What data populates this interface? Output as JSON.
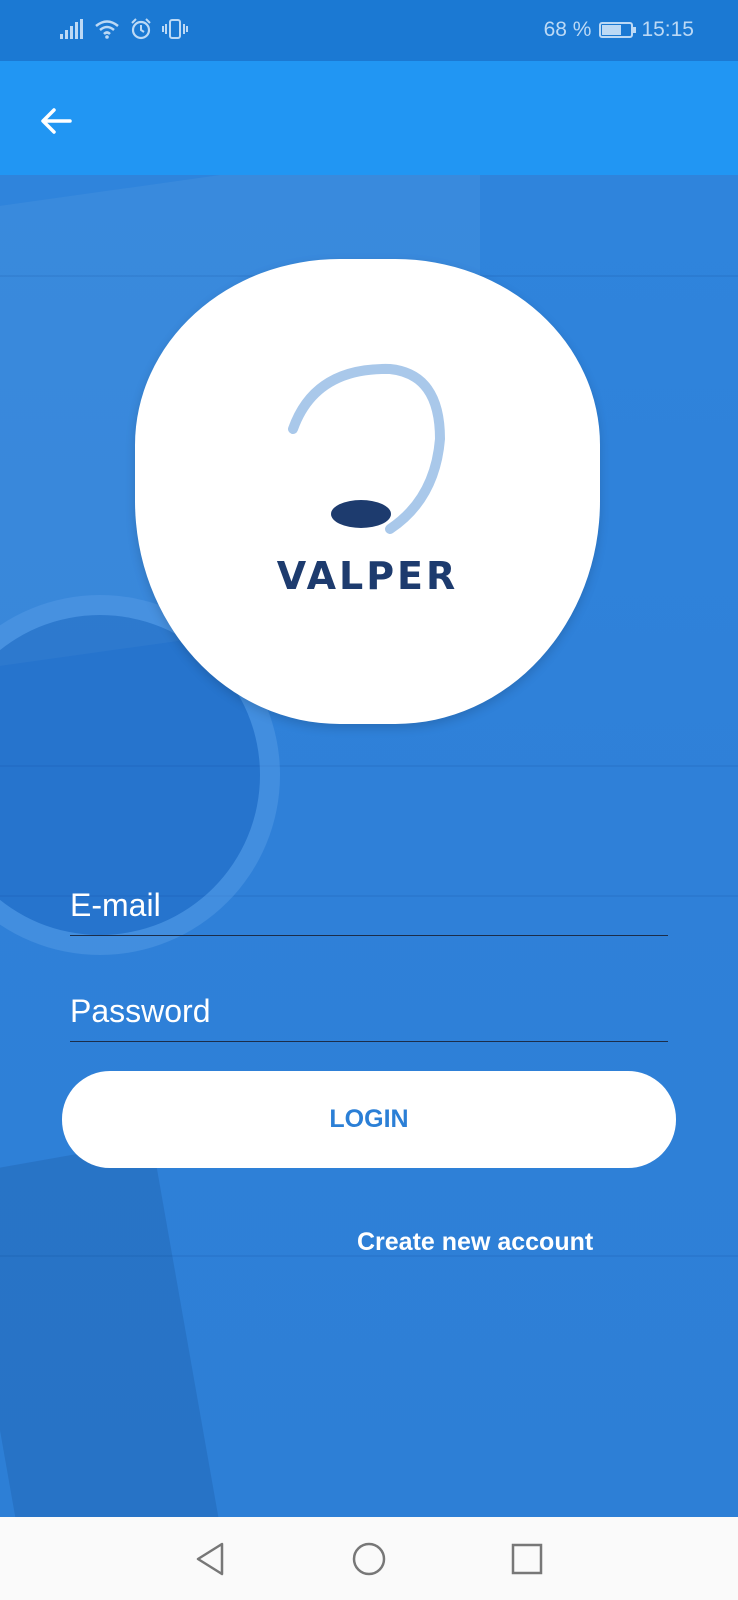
{
  "status_bar": {
    "battery_percent": "68 %",
    "battery_level": 0.68,
    "time": "15:15",
    "icons": [
      "signal-icon",
      "wifi-icon",
      "alarm-icon",
      "vibrate-icon",
      "battery-icon"
    ]
  },
  "app_bar": {
    "back_icon": "arrow-back-icon"
  },
  "logo": {
    "text": "VALPER",
    "colors": {
      "arc": "#a9c8ea",
      "ellipse": "#1d3b6e",
      "text": "#1d3b6e"
    }
  },
  "form": {
    "email_placeholder": "E-mail",
    "email_value": "",
    "password_placeholder": "Password",
    "password_value": "",
    "login_label": "LOGIN",
    "create_account_label": "Create new account"
  },
  "colors": {
    "primary": "#2196f3",
    "status_bar": "#1b79d3",
    "background": "#2f84dc",
    "button_text": "#2b7fd6"
  },
  "nav_bar": {
    "icons": [
      "back-triangle-icon",
      "home-circle-icon",
      "recents-square-icon"
    ]
  }
}
